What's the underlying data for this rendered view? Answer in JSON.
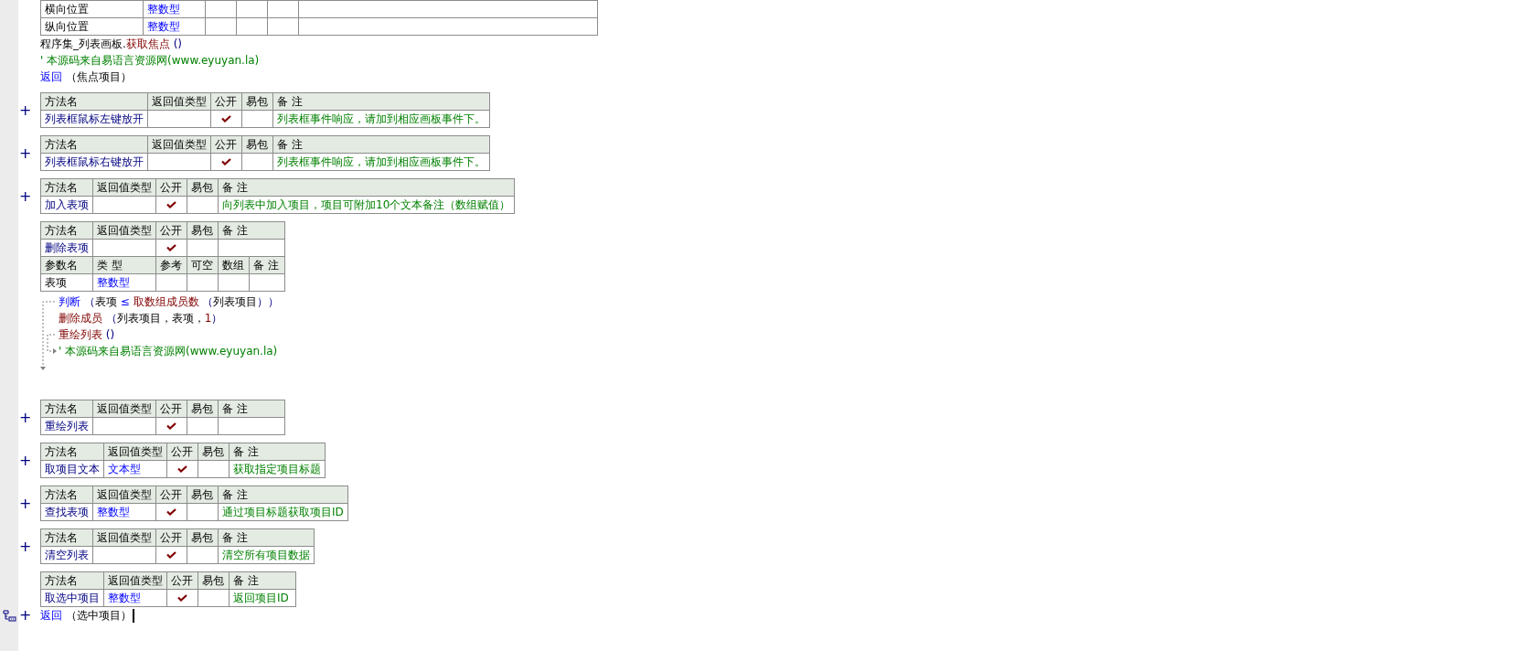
{
  "blocks": [
    {
      "kind": "var_table",
      "rows": [
        {
          "name": "横向位置",
          "type": "整数型"
        },
        {
          "name": "纵向位置",
          "type": "整数型"
        }
      ]
    },
    {
      "kind": "code",
      "lines": [
        {
          "segments": [
            {
              "kind": "plain",
              "text": "程序集_列表画板."
            },
            {
              "kind": "call",
              "text": "获取焦点"
            },
            {
              "kind": "paren",
              "text": " ()"
            }
          ]
        },
        {
          "segments": [
            {
              "kind": "comment",
              "text": "' 本源码来自易语言资源网(www.eyuyan.la)"
            }
          ]
        },
        {
          "segments": [
            {
              "kind": "keyword",
              "text": "返回"
            },
            {
              "kind": "plain",
              "text": " （焦点项目）"
            }
          ]
        }
      ]
    },
    {
      "kind": "method",
      "toggle": "+",
      "header": [
        "方法名",
        "返回值类型",
        "公开",
        "易包",
        "备 注"
      ],
      "name": "列表框鼠标左键放开",
      "public": true,
      "note": "列表框事件响应，请加到相应画板事件下。"
    },
    {
      "kind": "method",
      "toggle": "+",
      "header": [
        "方法名",
        "返回值类型",
        "公开",
        "易包",
        "备 注"
      ],
      "name": "列表框鼠标右键放开",
      "public": true,
      "note": "列表框事件响应，请加到相应画板事件下。"
    },
    {
      "kind": "method",
      "toggle": "+",
      "header": [
        "方法名",
        "返回值类型",
        "公开",
        "易包",
        "备 注"
      ],
      "name": "加入表项",
      "public": true,
      "note": "向列表中加入项目，项目可附加10个文本备注（数组赋值）"
    },
    {
      "kind": "method",
      "header": [
        "方法名",
        "返回值类型",
        "公开",
        "易包",
        "备 注"
      ],
      "name": "删除表项",
      "public": true,
      "params": {
        "header": [
          "参数名",
          "类 型",
          "参考",
          "可空",
          "数组",
          "备 注"
        ],
        "rows": [
          {
            "name": "表项",
            "type": "整数型"
          }
        ]
      },
      "body": [
        {
          "segments": [
            {
              "kind": "keyword",
              "text": "判断"
            },
            {
              "kind": "paren",
              "text": " （"
            },
            {
              "kind": "plain",
              "text": "表项"
            },
            {
              "kind": "keyword",
              "text": " ≤ "
            },
            {
              "kind": "call",
              "text": "取数组成员数"
            },
            {
              "kind": "paren",
              "text": " （"
            },
            {
              "kind": "plain",
              "text": "列表项目"
            },
            {
              "kind": "paren",
              "text": "））"
            }
          ],
          "children": [
            {
              "segments": [
                {
                  "kind": "call",
                  "text": "删除成员"
                },
                {
                  "kind": "paren",
                  "text": " （"
                },
                {
                  "kind": "plain",
                  "text": "列表项目，表项，"
                },
                {
                  "kind": "number",
                  "text": "1"
                },
                {
                  "kind": "paren",
                  "text": "）"
                }
              ]
            }
          ]
        },
        {
          "segments": [
            {
              "kind": "call",
              "text": "重绘列表"
            },
            {
              "kind": "paren",
              "text": " ()"
            }
          ]
        },
        {
          "segments": [
            {
              "kind": "comment",
              "text": "' 本源码来自易语言资源网(www.eyuyan.la)"
            }
          ]
        }
      ]
    },
    {
      "kind": "method",
      "toggle": "+",
      "header": [
        "方法名",
        "返回值类型",
        "公开",
        "易包",
        "备 注"
      ],
      "name": "重绘列表",
      "public": true
    },
    {
      "kind": "method",
      "toggle": "+",
      "header": [
        "方法名",
        "返回值类型",
        "公开",
        "易包",
        "备 注"
      ],
      "name": "取项目文本",
      "return_type": "文本型",
      "public": true,
      "note": "获取指定项目标题"
    },
    {
      "kind": "method",
      "toggle": "+",
      "header": [
        "方法名",
        "返回值类型",
        "公开",
        "易包",
        "备 注"
      ],
      "name": "查找表项",
      "return_type": "整数型",
      "public": true,
      "note": "通过项目标题获取项目ID"
    },
    {
      "kind": "method",
      "toggle": "+",
      "header": [
        "方法名",
        "返回值类型",
        "公开",
        "易包",
        "备 注"
      ],
      "name": "清空列表",
      "public": true,
      "note": "清空所有项目数据"
    },
    {
      "kind": "method",
      "header": [
        "方法名",
        "返回值类型",
        "公开",
        "易包",
        "备 注"
      ],
      "name": "取选中项目",
      "return_type": "整数型",
      "public": true,
      "note": "返回项目ID"
    },
    {
      "kind": "code",
      "lines": [
        {
          "toggle": "+",
          "current": true,
          "segments": [
            {
              "kind": "keyword",
              "text": "返回"
            },
            {
              "kind": "plain",
              "text": " （选中项目）"
            }
          ]
        }
      ]
    }
  ]
}
